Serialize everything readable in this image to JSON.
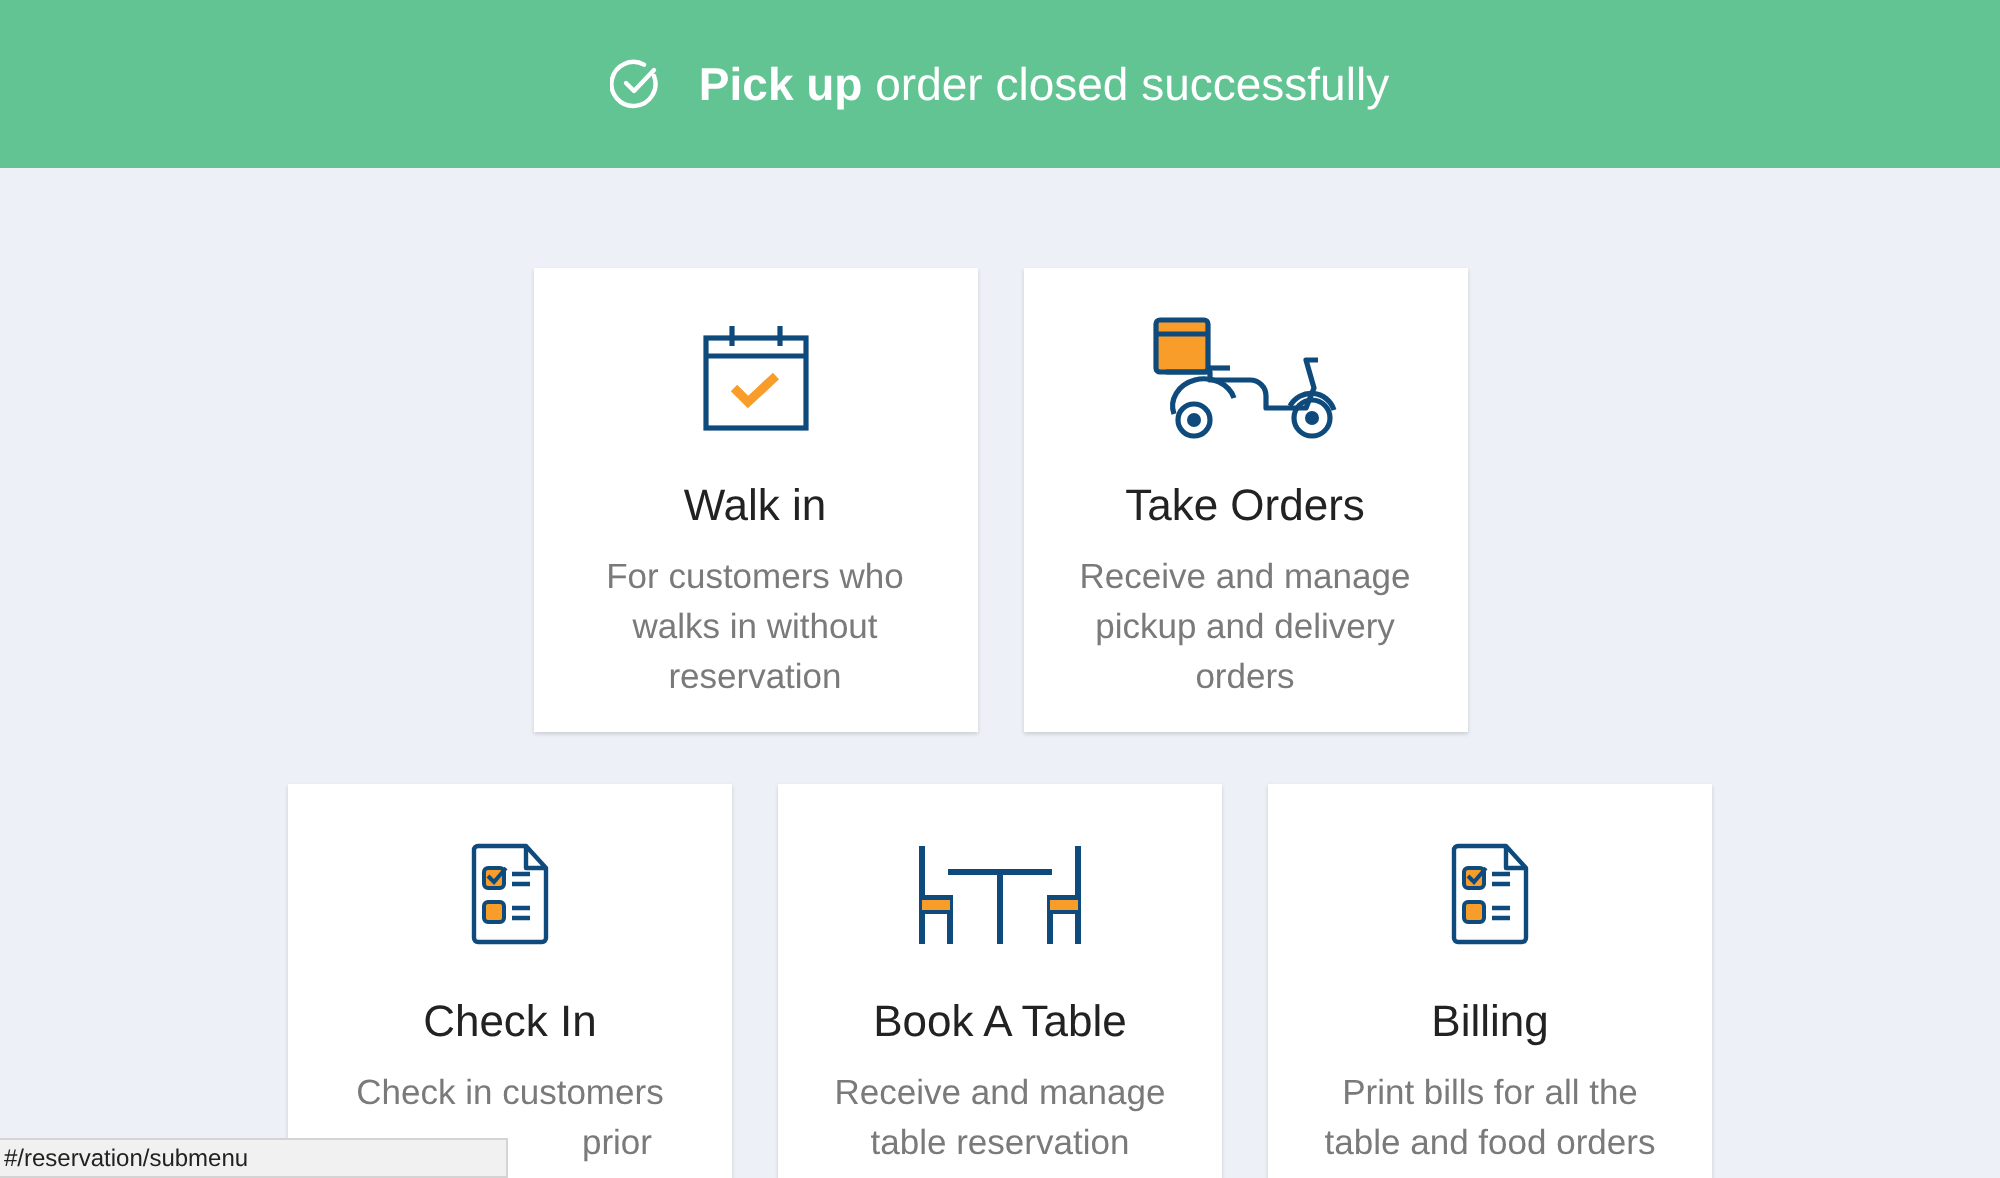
{
  "banner": {
    "text": "**Pick up** order closed successfully"
  },
  "rows": [
    {
      "cards": [
        {
          "kind": "calendar",
          "title": "Walk in",
          "description": [
            "For customers who",
            "walks in without",
            "reservation"
          ]
        },
        {
          "kind": "scooter",
          "title": "Take Orders",
          "description": [
            "Receive and manage",
            "pickup and delivery",
            "orders"
          ]
        }
      ]
    },
    {
      "cards": [
        {
          "kind": "checklist",
          "title": "Check In",
          "description": [
            "Check in customers",
            "prior"
          ],
          "last_line_cut": true
        },
        {
          "kind": "table",
          "title": "Book A Table",
          "description": [
            "Receive and manage",
            "table reservation"
          ]
        },
        {
          "kind": "checklist",
          "title": "Billing",
          "description": [
            "Print bills for all the",
            "table and food orders"
          ]
        }
      ]
    }
  ],
  "status_bar": {
    "url": "#/reservation/submenu"
  }
}
